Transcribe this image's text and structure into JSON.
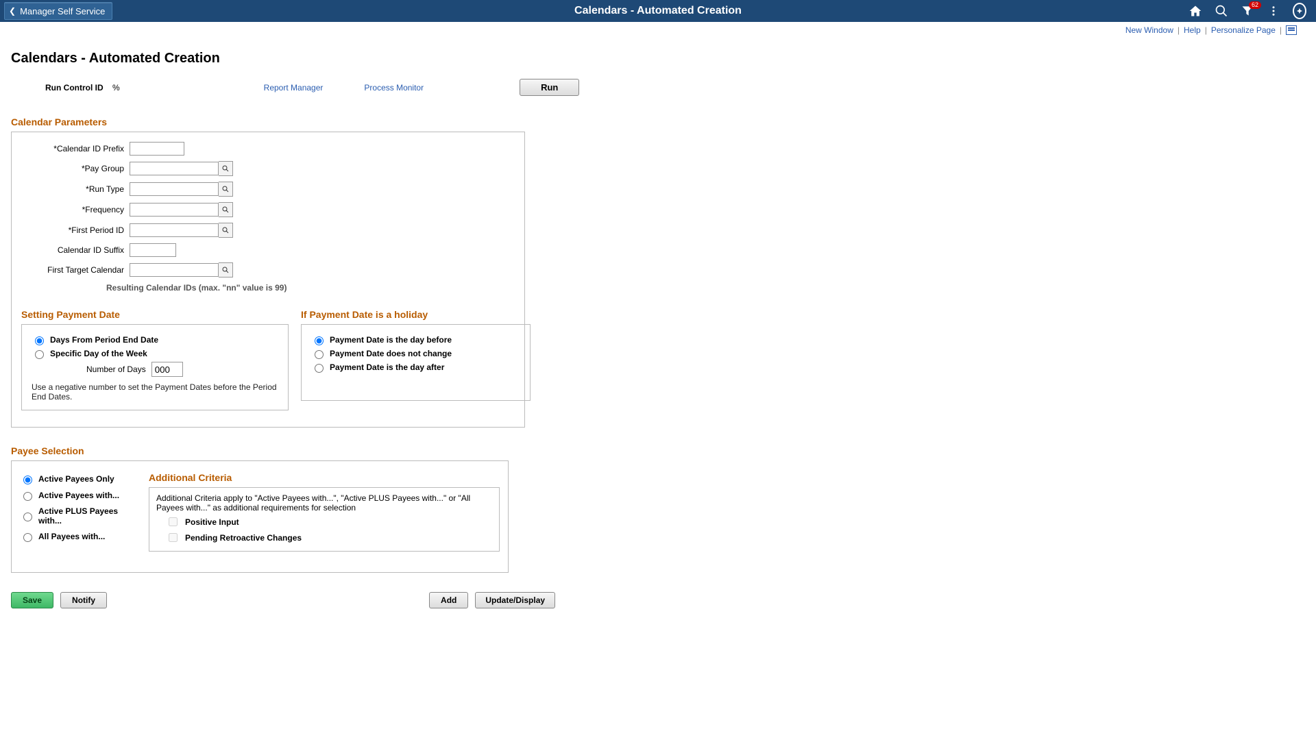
{
  "banner": {
    "back_label": "Manager Self Service",
    "title": "Calendars - Automated Creation",
    "notification_count": "62"
  },
  "linkbar": {
    "new_window": "New Window",
    "help": "Help",
    "personalize": "Personalize Page"
  },
  "page": {
    "title": "Calendars - Automated Creation"
  },
  "runcontrol": {
    "label": "Run Control ID",
    "value": "%",
    "report_manager": "Report Manager",
    "process_monitor": "Process Monitor",
    "run_label": "Run"
  },
  "params": {
    "heading": "Calendar Parameters",
    "fields": {
      "calendar_id_prefix": {
        "label": "*Calendar ID Prefix",
        "value": ""
      },
      "pay_group": {
        "label": "*Pay Group",
        "value": ""
      },
      "run_type": {
        "label": "*Run Type",
        "value": ""
      },
      "frequency": {
        "label": "*Frequency",
        "value": ""
      },
      "first_period_id": {
        "label": "*First Period ID",
        "value": ""
      },
      "calendar_id_suffix": {
        "label": "Calendar ID Suffix",
        "value": ""
      },
      "first_target_cal": {
        "label": "First Target Calendar",
        "value": ""
      }
    },
    "resulting_note": "Resulting Calendar IDs (max. \"nn\" value is 99)"
  },
  "payment_date": {
    "heading": "Setting Payment Date",
    "opt_days_from": "Days From Period End Date",
    "opt_specific": "Specific Day of the Week",
    "num_days_label": "Number of Days",
    "num_days_value": "000",
    "note": "Use a negative number to set the Payment Dates before the Period End Dates."
  },
  "holiday": {
    "heading": "If Payment Date is a holiday",
    "opt_before": "Payment Date is the day before",
    "opt_same": "Payment Date does not change",
    "opt_after": "Payment Date is the day after"
  },
  "payee": {
    "heading": "Payee Selection",
    "opt_active_only": "Active Payees Only",
    "opt_active_with": "Active Payees with...",
    "opt_active_plus": "Active PLUS Payees with...",
    "opt_all_with": "All Payees with...",
    "criteria": {
      "heading": "Additional Criteria",
      "desc": "Additional Criteria apply to \"Active Payees with...\", \"Active PLUS Payees with...\" or \"All Payees with...\" as additional requirements for selection",
      "chk_positive": "Positive Input",
      "chk_retro": "Pending Retroactive Changes"
    }
  },
  "buttons": {
    "save": "Save",
    "notify": "Notify",
    "add": "Add",
    "update": "Update/Display"
  }
}
